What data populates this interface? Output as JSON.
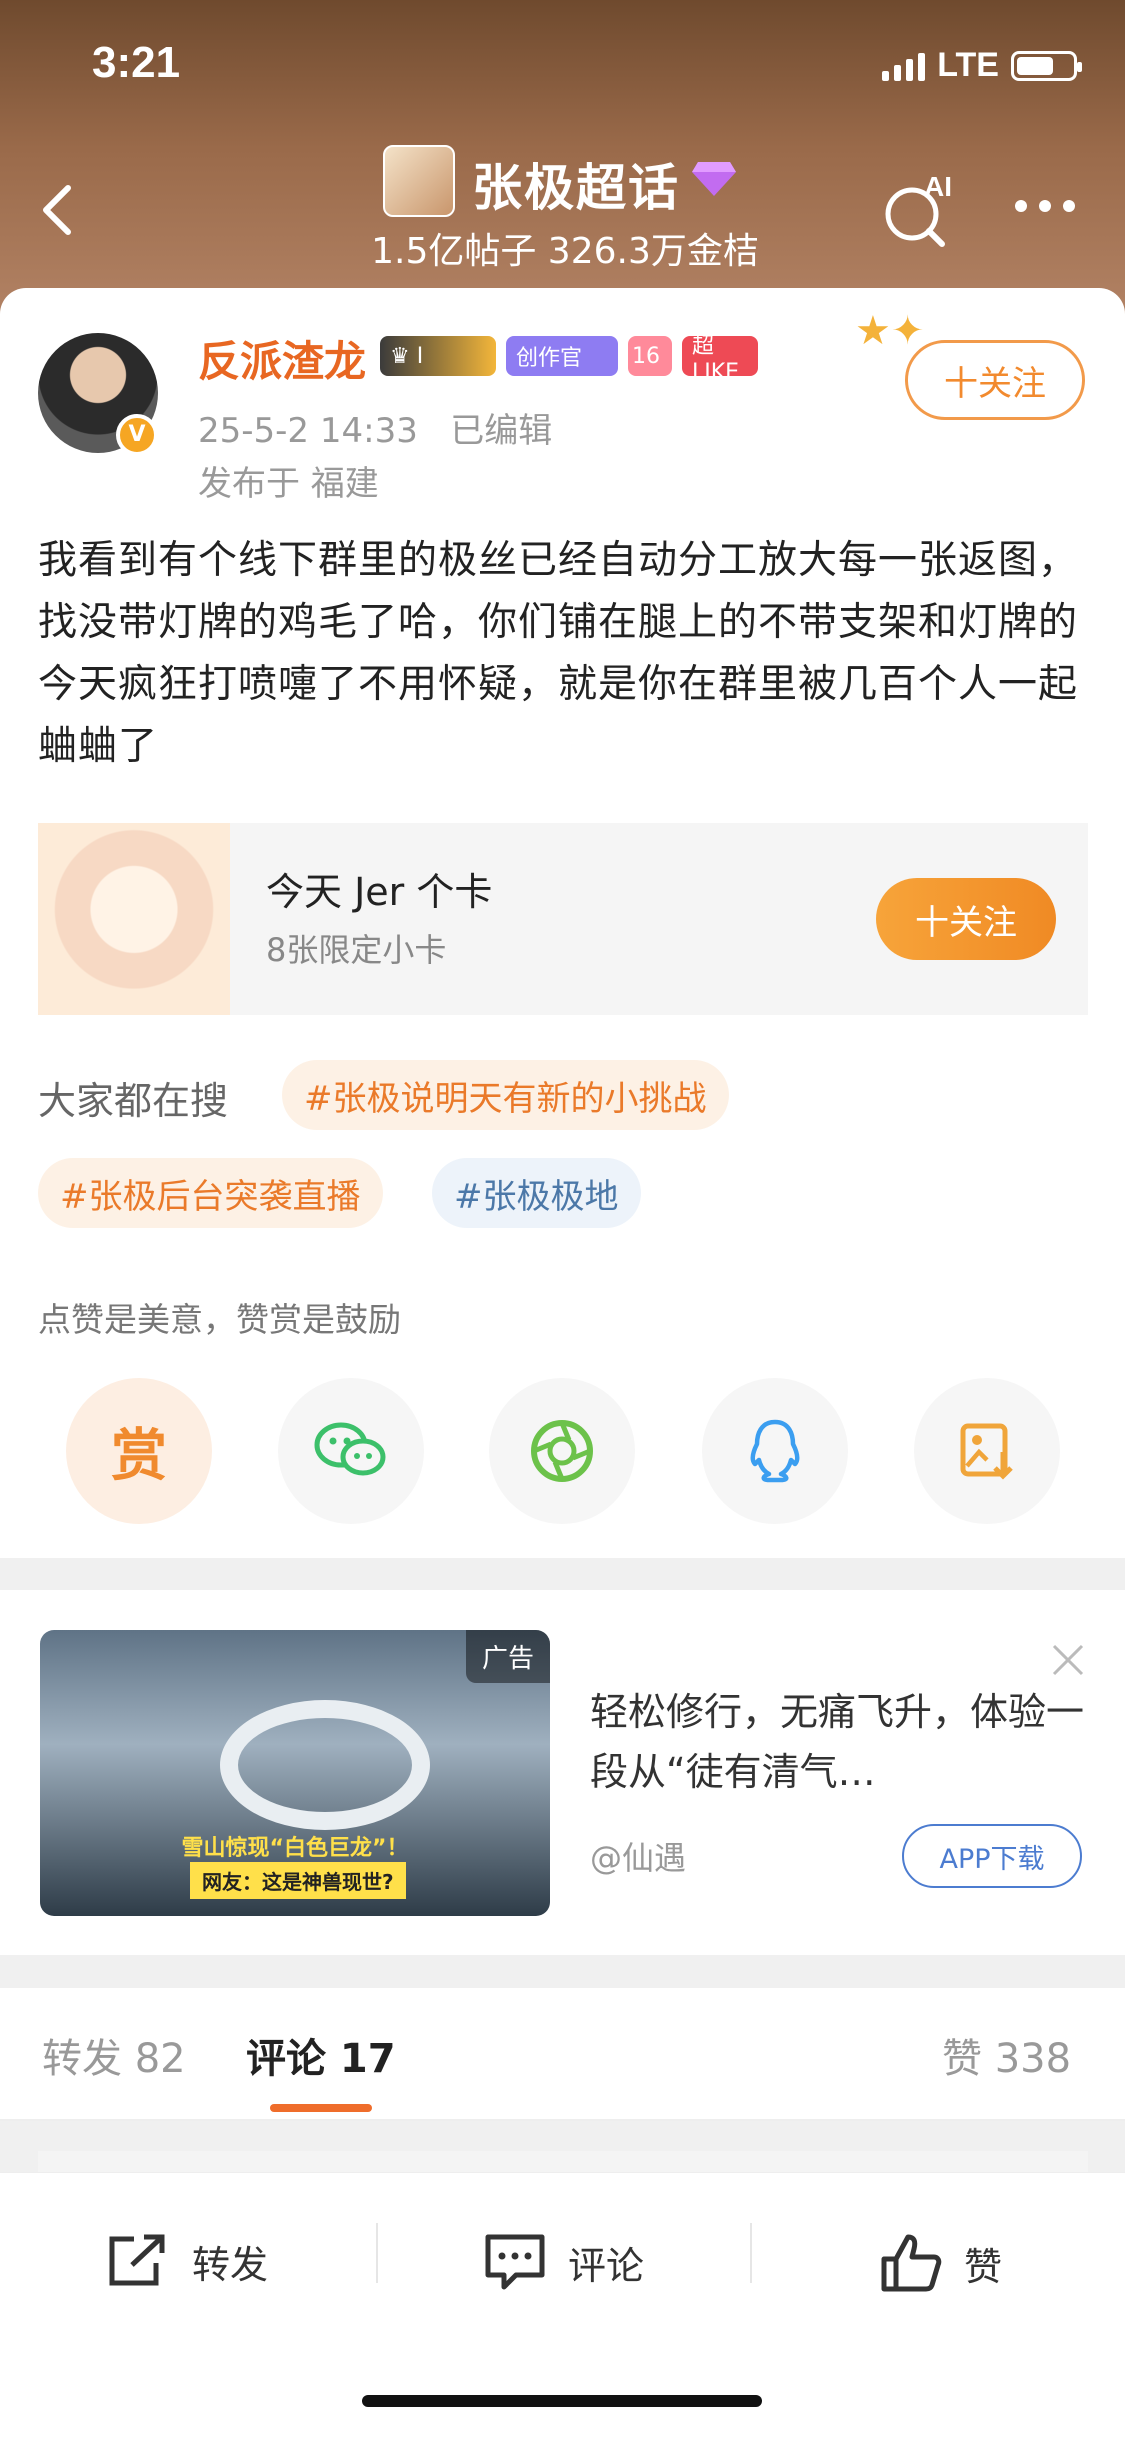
{
  "status_bar": {
    "time": "3:21",
    "network": "LTE"
  },
  "header": {
    "title": "张极超话",
    "stats": "1.5亿帖子 326.3万金桔",
    "ai_label": "AI"
  },
  "post": {
    "author": "反派渣龙",
    "badges": {
      "crown": "I",
      "creator": "创作官",
      "level": "16",
      "like": "超LIKE"
    },
    "time": "25-5-2 14:33",
    "edited": "已编辑",
    "location": "发布于 福建",
    "follow_label": "十关注",
    "text": "我看到有个线下群里的极丝已经自动分工放大每一张返图，找没带灯牌的鸡毛了哈，你们铺在腿上的不带支架和灯牌的今天疯狂打喷嚏了不用怀疑，就是你在群里被几百个人一起蛐蛐了"
  },
  "promo": {
    "title": "今天 Jer 个卡",
    "subtitle": "8张限定小卡",
    "follow_label": "十关注"
  },
  "search": {
    "label": "大家都在搜",
    "tags": [
      "#张极说明天有新的小挑战",
      "#张极后台突袭直播",
      "#张极极地"
    ]
  },
  "reward": {
    "text": "点赞是美意，赞赏是鼓励",
    "reward_label": "赏",
    "share_icons": [
      "wechat-icon",
      "moments-icon",
      "qq-icon",
      "save-image-icon"
    ]
  },
  "ad": {
    "tag": "广告",
    "caption_line1": "雪山惊现“白色巨龙”！",
    "caption_line2": "网友：这是神兽现世?",
    "text": "轻松修行，无痛飞升，体验一段从“徒有清气…",
    "author": "@仙遇",
    "download_label": "APP下载"
  },
  "tabs": {
    "repost": "转发 82",
    "comment": "评论 17",
    "like": "赞 338"
  },
  "bottom_bar": {
    "repost": "转发",
    "comment": "评论",
    "like": "赞"
  },
  "colors": {
    "accent": "#ef6d2b",
    "username": "#e86722",
    "tag_blue": "#4c78a8"
  }
}
